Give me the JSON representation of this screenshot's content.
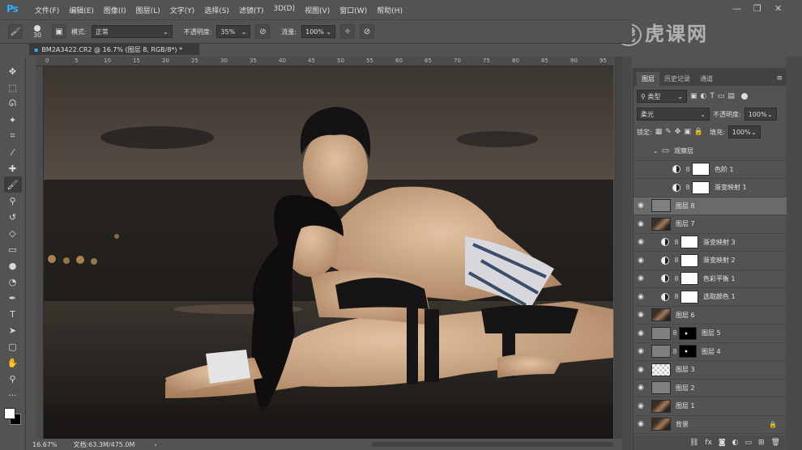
{
  "app": {
    "logo": "Ps"
  },
  "menu": [
    "文件(F)",
    "编辑(E)",
    "图像(I)",
    "图层(L)",
    "文字(Y)",
    "选择(S)",
    "滤镜(T)",
    "3D(D)",
    "视图(V)",
    "窗口(W)",
    "帮助(H)"
  ],
  "options": {
    "brush_size": "30",
    "mode_label": "模式:",
    "mode_value": "正常",
    "opacity_label": "不透明度:",
    "opacity_value": "35%",
    "flow_label": "流量:",
    "flow_value": "100%"
  },
  "document": {
    "tab_title": "BM2A3422.CR2 @ 16.7% (图层 8, RGB/8*) *",
    "ruler_marks": [
      "0",
      "5",
      "10",
      "15",
      "20",
      "25",
      "30",
      "35",
      "40",
      "45",
      "50",
      "55",
      "60",
      "65",
      "70",
      "75",
      "80",
      "85",
      "90",
      "95"
    ],
    "zoom": "16.67%",
    "doc_info": "文档:63.3M/475.0M"
  },
  "watermark": "虎课网",
  "layers_panel": {
    "tabs": [
      "图层",
      "历史记录",
      "通道"
    ],
    "filter_kind": "类型",
    "blend_mode": "柔光",
    "opacity_label": "不透明度:",
    "opacity_value": "100%",
    "lock_label": "锁定:",
    "fill_label": "填充:",
    "fill_value": "100%",
    "layers": [
      {
        "name": "观察层",
        "type": "group",
        "visible": false
      },
      {
        "name": "色阶 1",
        "type": "adjustment",
        "visible": false,
        "indent": true
      },
      {
        "name": "渐变映射 1",
        "type": "adjustment",
        "visible": false,
        "indent": true
      },
      {
        "name": "图层 8",
        "type": "gray",
        "visible": true,
        "selected": true
      },
      {
        "name": "图层 7",
        "type": "photo",
        "visible": true
      },
      {
        "name": "渐变映射 3",
        "type": "adjustment",
        "visible": true
      },
      {
        "name": "渐变映射 2",
        "type": "adjustment",
        "visible": true
      },
      {
        "name": "色彩平衡 1",
        "type": "adjustment",
        "visible": true
      },
      {
        "name": "选取颜色 1",
        "type": "adjustment",
        "visible": true
      },
      {
        "name": "图层 6",
        "type": "photo",
        "visible": true
      },
      {
        "name": "图层 5",
        "type": "gray-mask",
        "visible": true
      },
      {
        "name": "图层 4",
        "type": "gray-mask",
        "visible": true
      },
      {
        "name": "图层 3",
        "type": "transparent",
        "visible": true
      },
      {
        "name": "图层 2",
        "type": "gray",
        "visible": true
      },
      {
        "name": "图层 1",
        "type": "photo",
        "visible": true
      },
      {
        "name": "背景",
        "type": "photo",
        "visible": true,
        "locked": true
      }
    ]
  },
  "colors": {
    "ui_bg": "#535353",
    "panel_dark": "#3c3c3c",
    "selected_row": "#6a6a6a",
    "ps_blue": "#31a8ff"
  }
}
